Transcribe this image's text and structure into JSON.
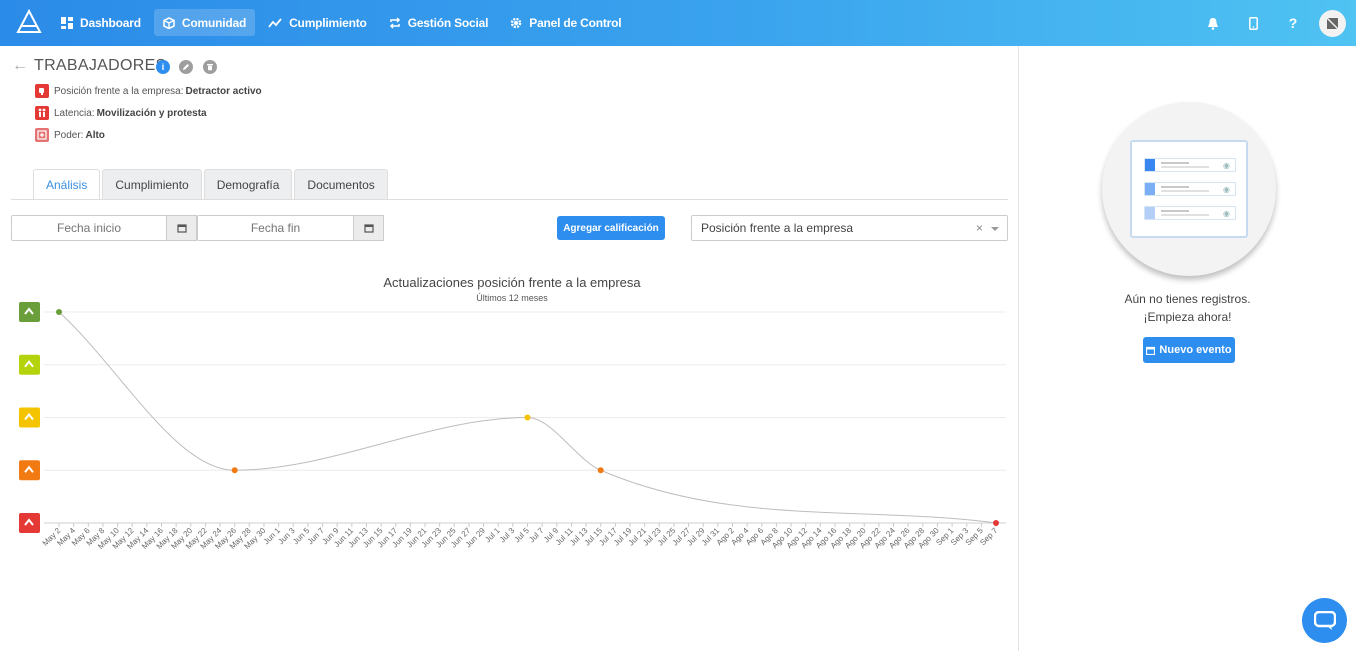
{
  "nav": {
    "items": [
      {
        "label": "Dashboard",
        "icon": "dashboard-icon",
        "active": false
      },
      {
        "label": "Comunidad",
        "icon": "cube-icon",
        "active": true
      },
      {
        "label": "Cumplimiento",
        "icon": "trend-icon",
        "active": false
      },
      {
        "label": "Gestión Social",
        "icon": "repeat-icon",
        "active": false
      },
      {
        "label": "Panel de Control",
        "icon": "gear-icon",
        "active": false
      }
    ],
    "help_label": "?"
  },
  "header": {
    "title": "TRABAJADORES",
    "attributes": [
      {
        "label": "Posición frente a la empresa:",
        "value": "Detractor activo",
        "color": "#e53935"
      },
      {
        "label": "Latencia:",
        "value": "Movilización y protesta",
        "color": "#e53935"
      },
      {
        "label": "Poder:",
        "value": "Alto",
        "color": "#e57373"
      }
    ]
  },
  "tabs": [
    "Análisis",
    "Cumplimiento",
    "Demografía",
    "Documentos"
  ],
  "filters": {
    "start_placeholder": "Fecha inicio",
    "end_placeholder": "Fecha fin",
    "add_button": "Agregar calificación",
    "select_value": "Posición frente a la empresa",
    "select_clear": "×"
  },
  "right_panel": {
    "empty_line1": "Aún no tienes registros.",
    "empty_line2": "¡Empieza ahora!",
    "new_event_button": "Nuevo evento"
  },
  "chart_data": {
    "type": "line",
    "title": "Actualizaciones posición frente a la empresa",
    "subtitle": "Últimos 12 meses",
    "levels": [
      {
        "level": 5,
        "color": "#6a9e3a"
      },
      {
        "level": 4,
        "color": "#b5d30c"
      },
      {
        "level": 3,
        "color": "#f5c400"
      },
      {
        "level": 2,
        "color": "#f27a12"
      },
      {
        "level": 1,
        "color": "#e53935"
      }
    ],
    "x_ticks": [
      "May 2",
      "May 4",
      "May 6",
      "May 8",
      "May 10",
      "May 12",
      "May 14",
      "May 16",
      "May 18",
      "May 20",
      "May 22",
      "May 24",
      "May 26",
      "May 28",
      "May 30",
      "Jun 1",
      "Jun 3",
      "Jun 5",
      "Jun 7",
      "Jun 9",
      "Jun 11",
      "Jun 13",
      "Jun 15",
      "Jun 17",
      "Jun 19",
      "Jun 21",
      "Jun 23",
      "Jun 25",
      "Jun 27",
      "Jun 29",
      "Jul 1",
      "Jul 3",
      "Jul 5",
      "Jul 7",
      "Jul 9",
      "Jul 11",
      "Jul 13",
      "Jul 15",
      "Jul 17",
      "Jul 19",
      "Jul 21",
      "Jul 23",
      "Jul 25",
      "Jul 27",
      "Jul 29",
      "Jul 31",
      "Ago 2",
      "Ago 4",
      "Ago 6",
      "Ago 8",
      "Ago 10",
      "Ago 12",
      "Ago 14",
      "Ago 16",
      "Ago 18",
      "Ago 20",
      "Ago 22",
      "Ago 24",
      "Ago 26",
      "Ago 28",
      "Ago 30",
      "Sep 1",
      "Sep 3",
      "Sep 5",
      "Sep 7"
    ],
    "points": [
      {
        "x": "May 2",
        "y": 5
      },
      {
        "x": "May 26",
        "y": 2
      },
      {
        "x": "Jul 5",
        "y": 3
      },
      {
        "x": "Jul 15",
        "y": 2
      },
      {
        "x": "Sep 7",
        "y": 1
      }
    ],
    "ylim": [
      1,
      5
    ],
    "grid": true,
    "line_color": "#bdbdbd"
  }
}
